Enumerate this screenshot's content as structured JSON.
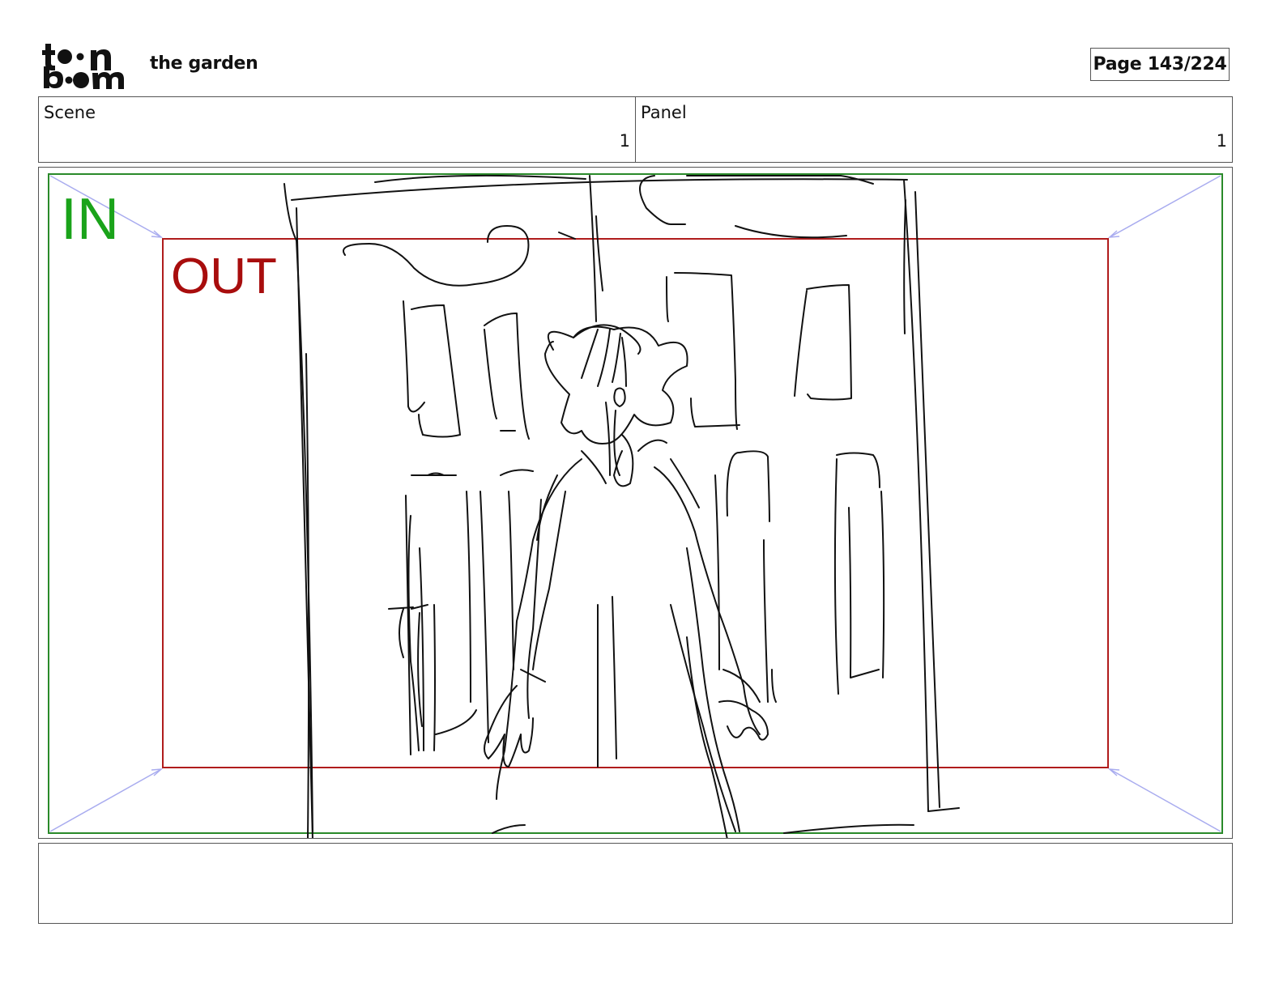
{
  "header": {
    "logo": {
      "name": "toon boom",
      "line1": "toon",
      "line2": "boom"
    },
    "project_title": "the garden",
    "page_label": "Page 143/224"
  },
  "info": {
    "scene_label": "Scene",
    "scene_value": "1",
    "panel_label": "Panel",
    "panel_value": "1"
  },
  "panel": {
    "in_label": "IN",
    "out_label": "OUT",
    "colors": {
      "in_frame": "#2a8a2a",
      "out_frame": "#b01c1c",
      "in_text": "#1aa31a",
      "out_text": "#a80d0d",
      "corner_arrows": "#a9acef",
      "sketch": "#111111"
    }
  },
  "notes": {
    "text": ""
  }
}
